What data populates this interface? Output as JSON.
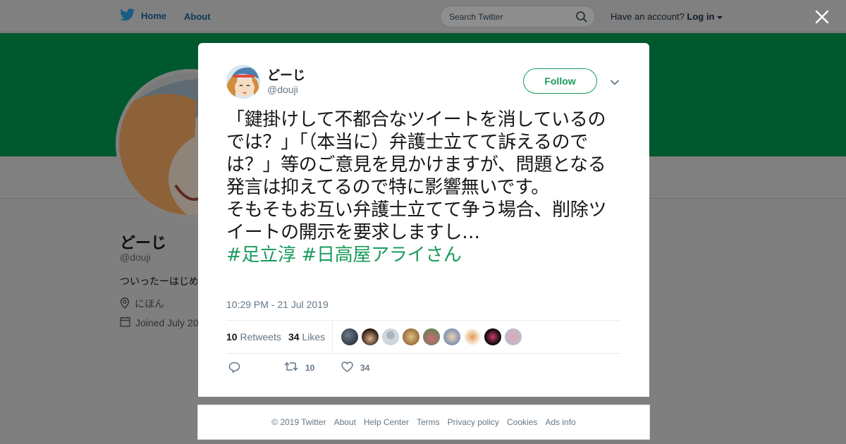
{
  "nav": {
    "home_label": "Home",
    "about_label": "About",
    "search_placeholder": "Search Twitter",
    "have_account": "Have an account?",
    "login_label": "Log in"
  },
  "profile": {
    "name": "どーじ",
    "handle": "@douji",
    "bio": "ついったーはじめ",
    "location": "にほん",
    "joined": "Joined July 20"
  },
  "tweet": {
    "author_name": "どーじ",
    "author_handle": "@douji",
    "follow_label": "Follow",
    "text_line1": "「鍵掛けして不都合なツイートを消しているのでは？」「（本当に）弁護士立てて訴えるのでは？」等のご意見を見かけますが、問題となる発言は抑えてるので特に影響無いです。",
    "text_line2": "そもそもお互い弁護士立てて争う場合、削除ツイートの開示を要求しますし…",
    "hashtags": "#足立淳 #日高屋アライさん",
    "timestamp": "10:29 PM - 21 Jul 2019",
    "retweets_count": "10",
    "retweets_label": "Retweets",
    "likes_count": "34",
    "likes_label": "Likes",
    "action_retweet_count": "10",
    "action_like_count": "34"
  },
  "colors": {
    "brand_green": "#1b9a5b",
    "banner_green": "#00582f",
    "twitter_blue": "#1da1f2"
  },
  "footer": {
    "copyright": "© 2019 Twitter",
    "links": [
      "About",
      "Help Center",
      "Terms",
      "Privacy policy",
      "Cookies",
      "Ads info"
    ]
  }
}
